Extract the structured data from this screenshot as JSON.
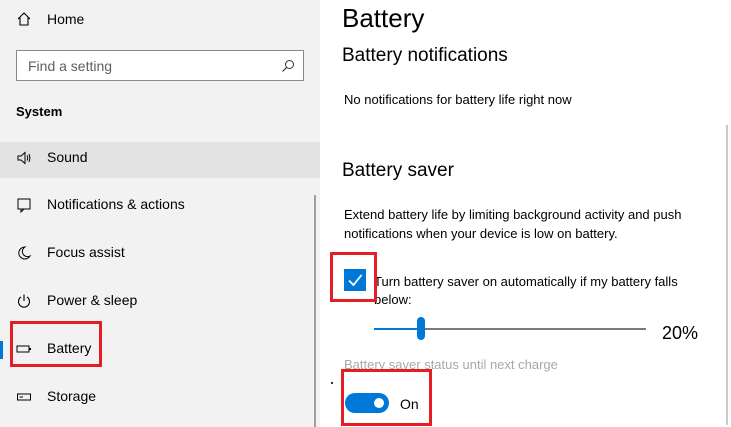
{
  "sidebar": {
    "home_label": "Home",
    "search_placeholder": "Find a setting",
    "section_title": "System",
    "items": [
      {
        "label": "Sound",
        "icon": "speaker-icon"
      },
      {
        "label": "Notifications & actions",
        "icon": "notification-icon"
      },
      {
        "label": "Focus assist",
        "icon": "moon-icon"
      },
      {
        "label": "Power & sleep",
        "icon": "power-icon"
      },
      {
        "label": "Battery",
        "icon": "battery-icon",
        "selected": true
      },
      {
        "label": "Storage",
        "icon": "storage-icon"
      }
    ]
  },
  "main": {
    "title": "Battery",
    "notifications": {
      "heading": "Battery notifications",
      "text": "No notifications for battery life right now"
    },
    "saver": {
      "heading": "Battery saver",
      "description": "Extend battery life by limiting background activity and push notifications when your device is low on battery.",
      "checkbox_label": "Turn battery saver on automatically if my battery falls below:",
      "checkbox_checked": true,
      "threshold_value": "20%",
      "threshold_fraction": 0.2,
      "status_label": "Battery saver status until next charge",
      "toggle_state": "On",
      "toggle_on": true
    }
  },
  "colors": {
    "accent": "#0078d7",
    "highlight_box": "#e31e24",
    "sidebar_bg": "#f2f2f2"
  }
}
